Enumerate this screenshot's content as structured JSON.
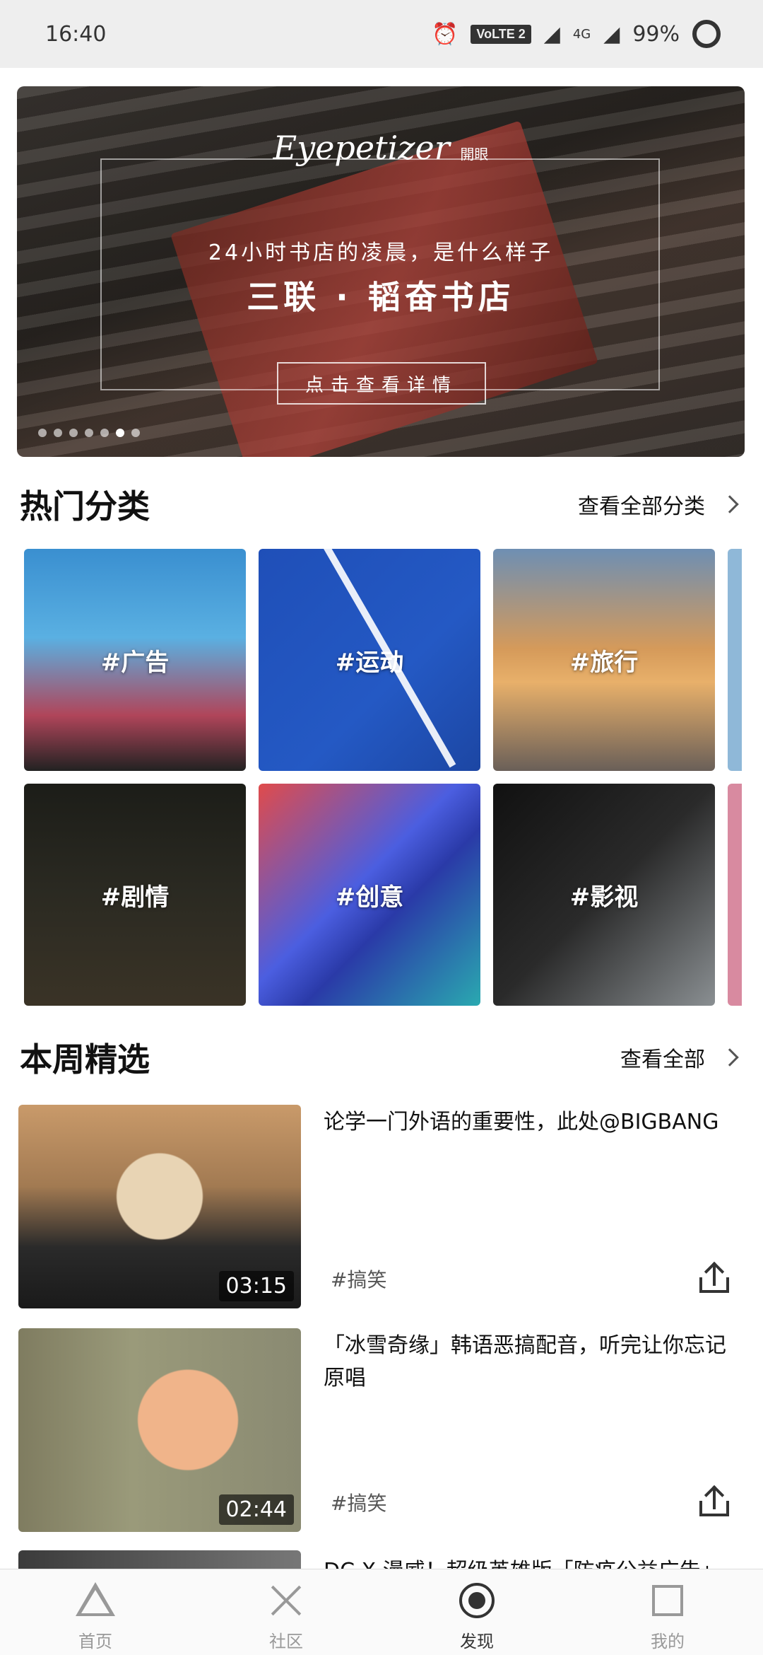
{
  "status_bar": {
    "time": "16:40",
    "volte": "VoLTE 2",
    "network": "4G",
    "battery": "99%",
    "icons": [
      "alarm-icon",
      "signal-icon",
      "battery-icon"
    ]
  },
  "banner": {
    "logo": "Eyepetizer",
    "logo_cn": "開眼",
    "subtitle": "24小时书店的凌晨，是什么样子",
    "headline": "三联 · 韬奋书店",
    "cta": "点击查看详情",
    "dot_count": 7,
    "active_dot": 5
  },
  "hot_categories": {
    "title": "热门分类",
    "more": "查看全部分类",
    "items": [
      {
        "label": "#广告"
      },
      {
        "label": "#运动"
      },
      {
        "label": "#旅行"
      },
      {
        "label": "#剧情"
      },
      {
        "label": "#创意"
      },
      {
        "label": "#影视"
      }
    ]
  },
  "weekly": {
    "title": "本周精选",
    "more": "查看全部",
    "items": [
      {
        "title": "论学一门外语的重要性，此处@BIGBANG",
        "tag": "#搞笑",
        "duration": "03:15"
      },
      {
        "title": "「冰雪奇缘」韩语恶搞配音，听完让你忘记原唱",
        "tag": "#搞笑",
        "duration": "02:44"
      },
      {
        "title": "DC X 漫威！超级英雄版「防疫公益广告」"
      }
    ]
  },
  "bottom_nav": {
    "items": [
      {
        "label": "首页",
        "icon": "triangle-icon"
      },
      {
        "label": "社区",
        "icon": "cross-icon"
      },
      {
        "label": "发现",
        "icon": "discover-icon",
        "active": true
      },
      {
        "label": "我的",
        "icon": "square-icon"
      }
    ]
  },
  "colors": {
    "status_bar_bg": "#eeeeee",
    "nav_active": "#333333",
    "nav_inactive": "#999999"
  }
}
